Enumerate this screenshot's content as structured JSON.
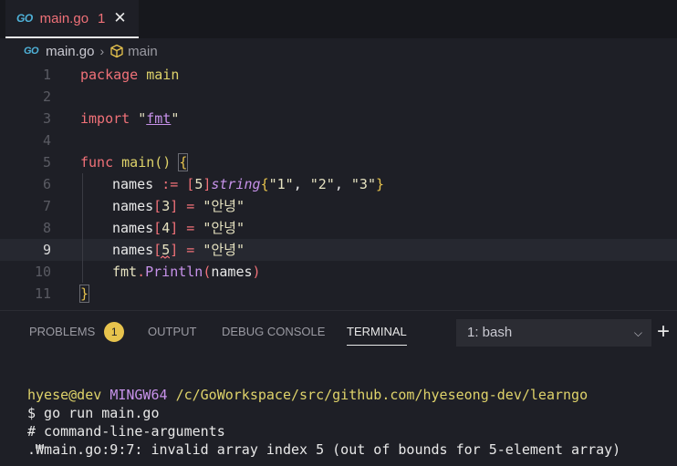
{
  "tab": {
    "icon": "go-file-icon",
    "icon_text": "GO",
    "name": "main.go",
    "problem_count": "1",
    "close": "✕"
  },
  "breadcrumb": {
    "file": "main.go",
    "separator": "›",
    "symbol": "main"
  },
  "editor": {
    "line_numbers": [
      "1",
      "2",
      "3",
      "4",
      "5",
      "6",
      "7",
      "8",
      "9",
      "10",
      "11"
    ],
    "current_line": 9,
    "l1": {
      "kw": "package",
      "name": "main"
    },
    "l3": {
      "kw": "import",
      "q1": "\"",
      "pkg": "fmt",
      "q2": "\""
    },
    "l5": {
      "kw": "func",
      "name": "main",
      "parens": "()",
      "brace": "{"
    },
    "l6": {
      "id": "names",
      "op": ":=",
      "b1": "[",
      "size": "5",
      "b2": "]",
      "typ": "string",
      "ob": "{",
      "v1": "\"1\"",
      "c1": ", ",
      "v2": "\"2\"",
      "c2": ", ",
      "v3": "\"3\"",
      "cb": "}"
    },
    "l7": {
      "id": "names",
      "b1": "[",
      "idx": "3",
      "b2": "]",
      "op": " = ",
      "val": "\"안녕\""
    },
    "l8": {
      "id": "names",
      "b1": "[",
      "idx": "4",
      "b2": "]",
      "op": " = ",
      "val": "\"안녕\""
    },
    "l9": {
      "id": "names",
      "b1": "[",
      "idx": "5",
      "b2": "]",
      "op": " = ",
      "val": "\"안녕\""
    },
    "l10": {
      "pkg": "fmt",
      "dot": ".",
      "fn": "Println",
      "p1": "(",
      "arg": "names",
      "p2": ")"
    },
    "l11": {
      "brace": "}"
    }
  },
  "panel": {
    "tabs": [
      "PROBLEMS",
      "OUTPUT",
      "DEBUG CONSOLE",
      "TERMINAL"
    ],
    "problems_badge": "1",
    "active_tab": "TERMINAL",
    "terminal_select": "1: bash",
    "add_terminal": "+"
  },
  "terminal": {
    "user": "hyese@dev",
    "host": "MINGW64",
    "path": "/c/GoWorkspace/src/github.com/hyeseong-dev/learngo",
    "command": "$ go run main.go",
    "out1": "# command-line-arguments",
    "out2": ".₩main.go:9:7: invalid array index 5 (out of bounds for 5-element array)"
  }
}
